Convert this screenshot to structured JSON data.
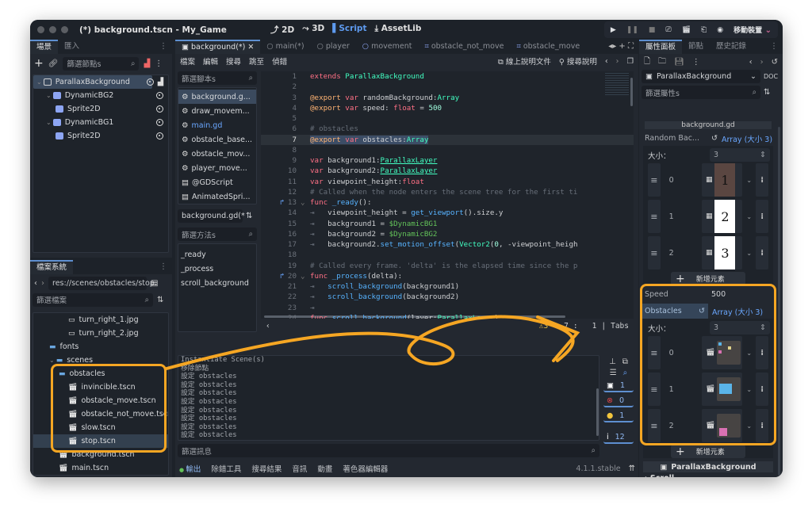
{
  "window": {
    "title": "(*) background.tscn - My_Game",
    "main_buttons": [
      {
        "label": "2D",
        "icon": "2d-icon",
        "active": false
      },
      {
        "label": "3D",
        "icon": "3d-icon",
        "active": false
      },
      {
        "label": "Script",
        "icon": "script-icon",
        "active": true
      },
      {
        "label": "AssetLib",
        "icon": "assetlib-icon",
        "active": false
      }
    ],
    "run_buttons": [
      "play-icon",
      "pause-icon",
      "stop-icon",
      "remote-debug-icon",
      "play-scene-icon",
      "play-custom-scene-icon",
      "movie-maker-icon"
    ],
    "device_label": "移動裝置",
    "device_color": "#d26a9a"
  },
  "scene_dock": {
    "tabs": [
      "場景",
      "匯入"
    ],
    "filter_placeholder": "篩選節點s",
    "nodes": [
      {
        "label": "ParallaxBackground",
        "depth": 0,
        "type": "parallax",
        "selected": true,
        "has_script": true
      },
      {
        "label": "DynamicBG2",
        "depth": 1,
        "type": "layer",
        "selected": false
      },
      {
        "label": "Sprite2D",
        "depth": 2,
        "type": "sprite",
        "selected": false
      },
      {
        "label": "DynamicBG1",
        "depth": 1,
        "type": "layer",
        "selected": false
      },
      {
        "label": "Sprite2D",
        "depth": 2,
        "type": "sprite",
        "selected": false
      }
    ]
  },
  "filesystem_dock": {
    "tab": "檔案系統",
    "path": "res://scenes/obstacles/stop.",
    "filter_placeholder": "篩選檔案",
    "items": [
      {
        "label": "turn_right_1.jpg",
        "type": "image",
        "depth": 3
      },
      {
        "label": "turn_right_2.jpg",
        "type": "image",
        "depth": 3
      },
      {
        "label": "fonts",
        "type": "folder",
        "depth": 1
      },
      {
        "label": "scenes",
        "type": "folder",
        "depth": 1
      },
      {
        "label": "obstacles",
        "type": "folder",
        "depth": 2
      },
      {
        "label": "invincible.tscn",
        "type": "scene",
        "depth": 3
      },
      {
        "label": "obstacle_move.tscn",
        "type": "scene",
        "depth": 3
      },
      {
        "label": "obstacle_not_move.tscn",
        "type": "scene",
        "depth": 3
      },
      {
        "label": "slow.tscn",
        "type": "scene",
        "depth": 3
      },
      {
        "label": "stop.tscn",
        "type": "scene",
        "depth": 3,
        "selected": true
      },
      {
        "label": "background.tscn",
        "type": "scene",
        "depth": 2
      },
      {
        "label": "main.tscn",
        "type": "scene",
        "depth": 2
      }
    ]
  },
  "script_editor": {
    "tabs": [
      {
        "label": "background(*)",
        "active": true,
        "icon": "parallax-icon"
      },
      {
        "label": "main(*)",
        "icon": "node-icon"
      },
      {
        "label": "player",
        "icon": "node-icon"
      },
      {
        "label": "movement",
        "icon": "node-icon"
      },
      {
        "label": "obstacle_not_move",
        "icon": "area-icon"
      },
      {
        "label": "obstacle_move",
        "icon": "area-icon"
      }
    ],
    "menu": [
      "檔案",
      "編輯",
      "搜尋",
      "跳至",
      "偵錯"
    ],
    "online_docs": "線上說明文件",
    "search_help": "搜尋說明",
    "scripts_filter": "篩選腳本s",
    "scripts": [
      {
        "label": "background.g...",
        "type": "gd",
        "selected": true
      },
      {
        "label": "draw_movem...",
        "type": "gd"
      },
      {
        "label": "main.gd",
        "type": "gd",
        "highlight": true
      },
      {
        "label": "obstacle_base...",
        "type": "gd"
      },
      {
        "label": "obstacle_mov...",
        "type": "gd"
      },
      {
        "label": "player_move...",
        "type": "gd"
      },
      {
        "label": "@GDScript",
        "type": "doc"
      },
      {
        "label": "AnimatedSpri...",
        "type": "doc"
      }
    ],
    "current_script": "background.gd(*",
    "methods_filter": "篩選方法s",
    "methods": [
      "_ready",
      "_process",
      "scroll_background"
    ],
    "code_lines": [
      {
        "n": "1",
        "html": "<span class='k'>extends</span> <span class='t'>ParallaxBackground</span>"
      },
      {
        "n": "2",
        "html": ""
      },
      {
        "n": "3",
        "html": "<span class='an'>@export</span> <span class='k'>var</span> randomBackground:<span class='t'>Array</span>"
      },
      {
        "n": "4",
        "html": "<span class='an'>@export</span> <span class='k'>var</span> speed: <span class='k'>float</span> = <span class='n'>500</span>"
      },
      {
        "n": "5",
        "html": ""
      },
      {
        "n": "6",
        "html": "<span class='cm'># obstacles</span>"
      },
      {
        "n": "7",
        "html": "<span class='sel'><span class='an'>@export</span> <span class='k'>var</span> obstacles:<span class='t'>Array</span></span>",
        "current": true
      },
      {
        "n": "8",
        "html": ""
      },
      {
        "n": "9",
        "html": "<span class='k'>var</span> background1:<span class='t ul'>ParallaxLayer</span>"
      },
      {
        "n": "10",
        "html": "<span class='k'>var</span> background2:<span class='t ul'>ParallaxLayer</span>"
      },
      {
        "n": "11",
        "html": "<span class='k'>var</span> viewpoint_height:<span class='k'>float</span>"
      },
      {
        "n": "12",
        "html": "<span class='cm'># Called when the node enters the scene tree for the first ti</span>"
      },
      {
        "n": "13",
        "html": "<span class='k'>func</span> <span class='fn'>_ready</span>():",
        "override": true,
        "fold": true
      },
      {
        "n": "14",
        "html": "<span class='cm'>⇥</span>   viewpoint_height = <span class='fn'>get_viewport</span>().size.y"
      },
      {
        "n": "15",
        "html": "<span class='cm'>⇥</span>   background1 = <span class='np'>$DynamicBG1</span>"
      },
      {
        "n": "16",
        "html": "<span class='cm'>⇥</span>   background2 = <span class='np'>$DynamicBG2</span>"
      },
      {
        "n": "17",
        "html": "<span class='cm'>⇥</span>   background2.<span class='fn'>set_motion_offset</span>(<span class='t'>Vector2</span>(<span class='n'>0</span>, -viewpoint_heigh"
      },
      {
        "n": "18",
        "html": ""
      },
      {
        "n": "19",
        "html": "<span class='cm'># Called every frame. 'delta' is the elapsed time since the p</span>"
      },
      {
        "n": "20",
        "html": "<span class='k'>func</span> <span class='fn'>_process</span>(delta):",
        "override": true,
        "fold": true
      },
      {
        "n": "21",
        "html": "<span class='cm'>⇥</span>   <span class='fn'>scroll_background</span>(background1)"
      },
      {
        "n": "22",
        "html": "<span class='cm'>⇥</span>   <span class='fn'>scroll_background</span>(background2)"
      },
      {
        "n": "23",
        "html": "<span class='cm'>⇥</span>"
      },
      {
        "n": "24",
        "html": "<span class='k'>func</span> <span class='fn'>scroll_background</span>(layer:<span class='t'>ParallaxLayer</span>):",
        "fold": true
      }
    ],
    "status": {
      "warnings": "3",
      "line": "7",
      "col": "1",
      "indent": "Tabs"
    }
  },
  "output_panel": {
    "lines": [
      "Instantiate Scene(s)",
      "移除節點",
      "設定 obstacles",
      "設定 obstacles",
      "設定 obstacles",
      "設定 obstacles",
      "設定 obstacles",
      "設定 obstacles",
      "設定 obstacles",
      "設定 obstacles"
    ],
    "filter_placeholder": "篩選訊息",
    "counts": {
      "errors_generic": "1",
      "errors": "0",
      "warnings": "1",
      "messages": "12"
    },
    "bottom_tabs": [
      "輸出",
      "除錯工具",
      "搜尋結果",
      "音訊",
      "動畫",
      "著色器編輯器"
    ],
    "version": "4.1.1.stable"
  },
  "inspector": {
    "tabs": [
      "屬性面板",
      "節點",
      "歷史記錄"
    ],
    "node_selector": "ParallaxBackground",
    "filter_placeholder": "篩選屬性s",
    "script_header": "background.gd",
    "random_background": {
      "label": "Random Bac...",
      "value": "Array (大小 3)",
      "size_label": "大小：",
      "size": "3",
      "items": [
        {
          "index": "0",
          "thumb_text": "1",
          "thumb_bg": "#5a4641",
          "thumb_fg": "#111111"
        },
        {
          "index": "1",
          "thumb_text": "2",
          "thumb_bg": "#ffffff",
          "thumb_fg": "#111111"
        },
        {
          "index": "2",
          "thumb_text": "3",
          "thumb_bg": "#ffffff",
          "thumb_fg": "#111111"
        }
      ],
      "add_label": "新增元素"
    },
    "speed": {
      "label": "Speed",
      "value": "500"
    },
    "obstacles": {
      "label": "Obstacles",
      "value": "Array (大小 3)",
      "size_label": "大小：",
      "size": "3",
      "items": [
        {
          "index": "0",
          "preview": "multi"
        },
        {
          "index": "1",
          "preview": "blue"
        },
        {
          "index": "2",
          "preview": "pink"
        }
      ],
      "add_label": "新增元素"
    },
    "section_label": "ParallaxBackground",
    "subsection_label": "Scroll"
  },
  "annotation_color": "#f5a623"
}
